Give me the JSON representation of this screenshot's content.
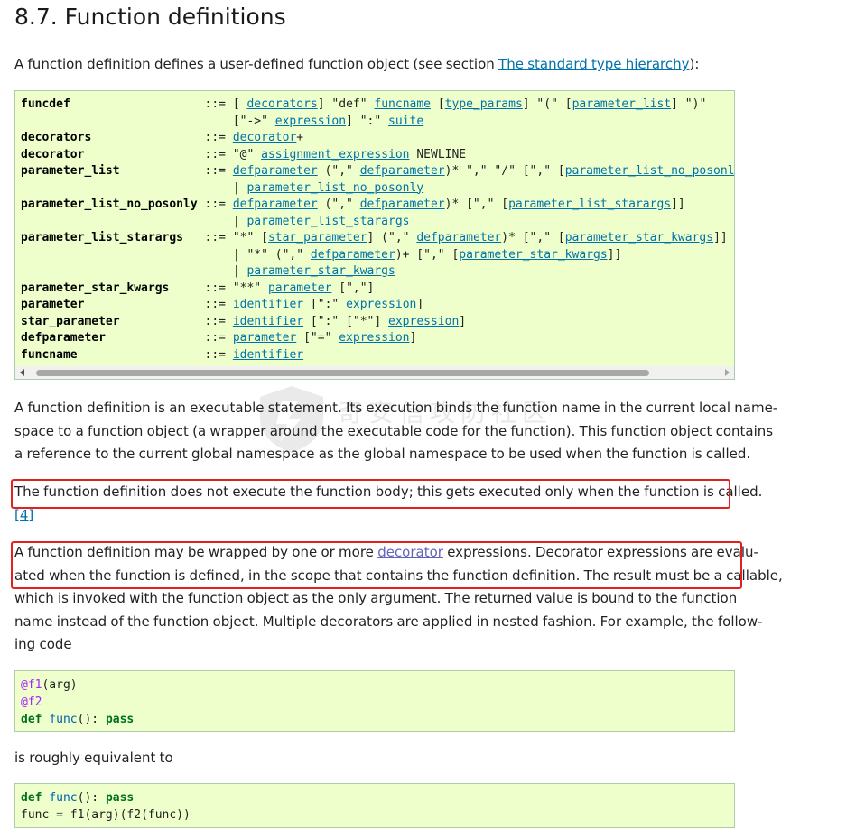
{
  "page": {
    "heading": "8.7. Function definitions",
    "intro": {
      "before": "A function definition defines a user-defined function object (see section ",
      "link": "The standard type hierarchy",
      "after": "):"
    },
    "para1": {
      "lines": [
        "A function definition is an executable statement. Its execution binds the function name in the current local name-",
        "space to a function object (a wrapper around the executable code for the function). This function object contains",
        "a reference to the current global namespace as the global namespace to be used when the function is called."
      ]
    },
    "para2": {
      "line1": "The function definition does not execute the function body; this gets executed only when the function is called.",
      "footnote": "[4]"
    },
    "para3": {
      "line1_before": "A function definition may be wrapped by one or more ",
      "line1_link": "decorator",
      "line1_after": " expressions. Decorator expressions are evalu-",
      "lines": [
        "ated when the function is defined, in the scope that contains the function definition. The result must be a callable,",
        "which is invoked with the function object as the only argument. The returned value is bound to the function",
        "name instead of the function object. Multiple decorators are applied in nested fashion. For example, the follow-",
        "ing code"
      ]
    },
    "para4": "is roughly equivalent to",
    "watermark": "奇安信攻防社区"
  },
  "grammar": {
    "rules": [
      {
        "name": "funcdef",
        "lines": [
          [
            [
              "t",
              "[ "
            ],
            [
              "r",
              "decorators"
            ],
            [
              "t",
              "] \"def\" "
            ],
            [
              "r",
              "funcname"
            ],
            [
              "t",
              " ["
            ],
            [
              "r",
              "type_params"
            ],
            [
              "t",
              "] \"(\" ["
            ],
            [
              "r",
              "parameter_list"
            ],
            [
              "t",
              "] \")\""
            ]
          ],
          [
            [
              "t",
              "[\"->\" "
            ],
            [
              "r",
              "expression"
            ],
            [
              "t",
              "] \":\" "
            ],
            [
              "r",
              "suite"
            ]
          ]
        ]
      },
      {
        "name": "decorators",
        "lines": [
          [
            [
              "r",
              "decorator"
            ],
            [
              "t",
              "+"
            ]
          ]
        ]
      },
      {
        "name": "decorator",
        "lines": [
          [
            [
              "t",
              "\"@\" "
            ],
            [
              "r",
              "assignment_expression"
            ],
            [
              "t",
              " NEWLINE"
            ]
          ]
        ]
      },
      {
        "name": "parameter_list",
        "lines": [
          [
            [
              "r",
              "defparameter"
            ],
            [
              "t",
              " (\",\" "
            ],
            [
              "r",
              "defparameter"
            ],
            [
              "t",
              ")* \",\" \"/\" [\",\" ["
            ],
            [
              "r",
              "parameter_list_no_posonly"
            ],
            [
              "t",
              "]]"
            ]
          ],
          [
            [
              "t",
              "| "
            ],
            [
              "r",
              "parameter_list_no_posonly"
            ]
          ]
        ]
      },
      {
        "name": "parameter_list_no_posonly",
        "lines": [
          [
            [
              "r",
              "defparameter"
            ],
            [
              "t",
              " (\",\" "
            ],
            [
              "r",
              "defparameter"
            ],
            [
              "t",
              ")* [\",\" ["
            ],
            [
              "r",
              "parameter_list_starargs"
            ],
            [
              "t",
              "]]"
            ]
          ],
          [
            [
              "t",
              "| "
            ],
            [
              "r",
              "parameter_list_starargs"
            ]
          ]
        ]
      },
      {
        "name": "parameter_list_starargs",
        "lines": [
          [
            [
              "t",
              "\"*\" ["
            ],
            [
              "r",
              "star_parameter"
            ],
            [
              "t",
              "] (\",\" "
            ],
            [
              "r",
              "defparameter"
            ],
            [
              "t",
              ")* [\",\" ["
            ],
            [
              "r",
              "parameter_star_kwargs"
            ],
            [
              "t",
              "]]"
            ]
          ],
          [
            [
              "t",
              "| \"*\" (\",\" "
            ],
            [
              "r",
              "defparameter"
            ],
            [
              "t",
              ")+ [\",\" ["
            ],
            [
              "r",
              "parameter_star_kwargs"
            ],
            [
              "t",
              "]]"
            ]
          ],
          [
            [
              "t",
              "| "
            ],
            [
              "r",
              "parameter_star_kwargs"
            ]
          ]
        ]
      },
      {
        "name": "parameter_star_kwargs",
        "lines": [
          [
            [
              "t",
              "\"**\" "
            ],
            [
              "r",
              "parameter"
            ],
            [
              "t",
              " [\",\"]"
            ]
          ]
        ]
      },
      {
        "name": "parameter",
        "lines": [
          [
            [
              "r",
              "identifier"
            ],
            [
              "t",
              " [\":\" "
            ],
            [
              "r",
              "expression"
            ],
            [
              "t",
              "]"
            ]
          ]
        ]
      },
      {
        "name": "star_parameter",
        "lines": [
          [
            [
              "r",
              "identifier"
            ],
            [
              "t",
              " [\":\" [\"*\"] "
            ],
            [
              "r",
              "expression"
            ],
            [
              "t",
              "]"
            ]
          ]
        ]
      },
      {
        "name": "defparameter",
        "lines": [
          [
            [
              "r",
              "parameter"
            ],
            [
              "t",
              " [\"=\" "
            ],
            [
              "r",
              "expression"
            ],
            [
              "t",
              "]"
            ]
          ]
        ]
      },
      {
        "name": "funcname",
        "lines": [
          [
            [
              "r",
              "identifier"
            ]
          ]
        ]
      }
    ],
    "separator": "::="
  },
  "code1": {
    "line1": {
      "deco": "@f1",
      "rest": "(arg)"
    },
    "line2": {
      "deco": "@f2"
    },
    "line3": {
      "kw": "def",
      "fn": "func",
      "paren": "():",
      "pass": "pass"
    }
  },
  "code2": {
    "line1": {
      "kw": "def",
      "fn": "func",
      "paren": "():",
      "pass": "pass"
    },
    "line2": {
      "lhs": "func",
      "op": "=",
      "rhs": "f1(arg)(f2(func))"
    }
  }
}
